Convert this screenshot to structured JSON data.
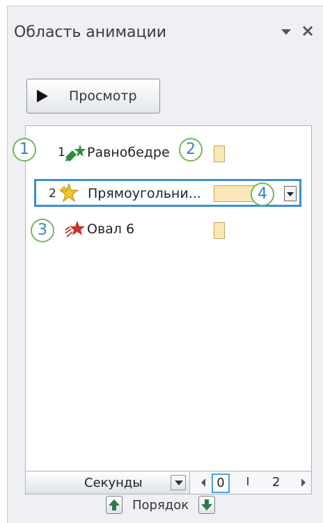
{
  "pane": {
    "title": "Область анимации",
    "dropdown_icon": "chevron-down-icon",
    "close_icon": "close-icon"
  },
  "toolbar": {
    "preview_label": "Просмотр"
  },
  "animations": [
    {
      "number": "1",
      "name": "Равнобедре",
      "icon": "entrance-effect-icon",
      "color": "#2f8a3d"
    },
    {
      "number": "2",
      "name": "Прямоугольни...",
      "icon": "emphasis-effect-icon",
      "color": "#e2b21c",
      "selected": true
    },
    {
      "number": "",
      "name": "Овал 6",
      "icon": "exit-effect-icon",
      "color": "#c8322b"
    }
  ],
  "callouts": [
    "1",
    "2",
    "3",
    "4"
  ],
  "timeline": {
    "unit_label": "Секунды",
    "start_value": "0",
    "end_value": "2"
  },
  "order": {
    "label": "Порядок"
  },
  "colors": {
    "accent": "#3b8fd0",
    "bar_fill": "#fbe8b8",
    "callout_border": "#74b45c",
    "callout_text": "#3d7fc2"
  }
}
